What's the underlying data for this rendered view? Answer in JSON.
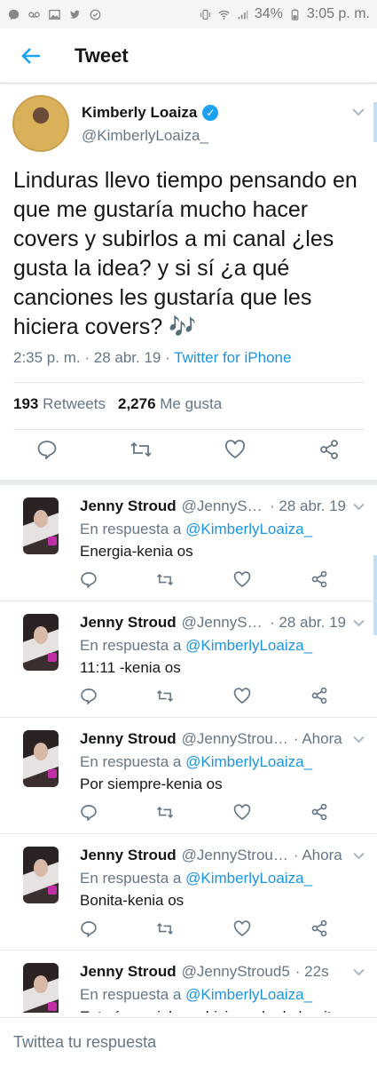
{
  "status_bar": {
    "battery": "34%",
    "time": "3:05 p. m."
  },
  "header": {
    "title": "Tweet"
  },
  "main_tweet": {
    "name": "Kimberly Loaiza",
    "handle": "@KimberlyLoaiza_",
    "text": "Linduras llevo tiempo pensando en que me gustaría mucho hacer covers y subirlos a mi canal ¿les gusta la idea? y si sí ¿a qué canciones les gustaría que les hiciera covers? 🎶",
    "time": "2:35 p. m.",
    "date": "28 abr. 19",
    "source": "Twitter for iPhone",
    "retweets_count": "193",
    "retweets_label": "Retweets",
    "likes_count": "2,276",
    "likes_label": "Me gusta"
  },
  "replies": [
    {
      "name": "Jenny Stroud",
      "handle": "@JennySt…",
      "time": "· 28 abr. 19",
      "reply_prefix": "En respuesta a",
      "reply_to": "@KimberlyLoaiza_",
      "text": "Energia-kenia os"
    },
    {
      "name": "Jenny Stroud",
      "handle": "@JennySt…",
      "time": "· 28 abr. 19",
      "reply_prefix": "En respuesta a",
      "reply_to": "@KimberlyLoaiza_",
      "text": "11:11 -kenia os"
    },
    {
      "name": "Jenny Stroud",
      "handle": "@JennyStrou…",
      "time": "· Ahora",
      "reply_prefix": "En respuesta a",
      "reply_to": "@KimberlyLoaiza_",
      "text": "Por siempre-kenia os"
    },
    {
      "name": "Jenny Stroud",
      "handle": "@JennyStrou…",
      "time": "· Ahora",
      "reply_prefix": "En respuesta a",
      "reply_to": "@KimberlyLoaiza_",
      "text": "Bonita-kenia os"
    },
    {
      "name": "Jenny Stroud",
      "handle": "@JennyStroud5",
      "time": "· 22s",
      "reply_prefix": "En respuesta a",
      "reply_to": "@KimberlyLoaiza_",
      "text": "Estaría genial  que hicieras  la de bonita"
    }
  ],
  "compose": {
    "placeholder": "Twittea tu respuesta"
  },
  "colors": {
    "accent": "#1da1f2",
    "link": "#1b95e0",
    "muted": "#657786",
    "divider": "#e1e8ed"
  }
}
